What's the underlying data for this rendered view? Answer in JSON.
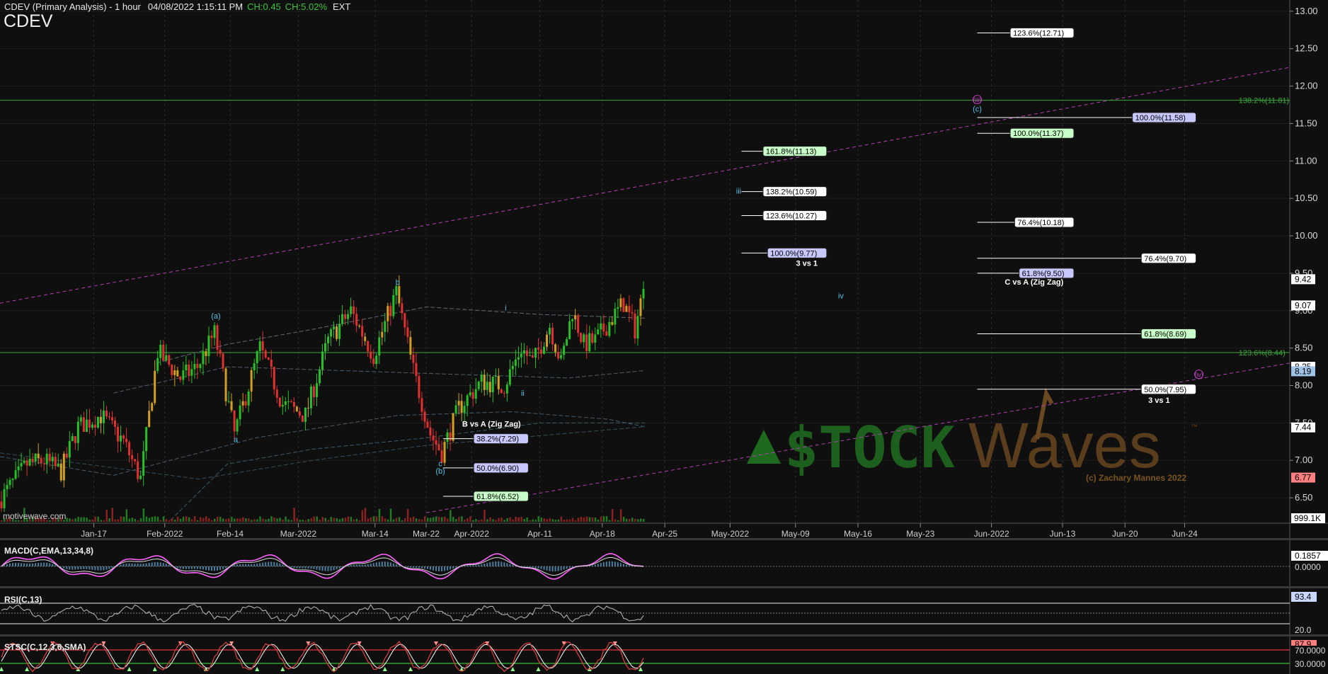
{
  "header": {
    "title": "CDEV (Primary Analysis) - 1 hour",
    "datetime": "04/08/2022 1:15:11 PM",
    "ch": "CH:0.45",
    "chpct": "CH:5.02%",
    "ext": "EXT",
    "symbol": "CDEV"
  },
  "watermark": {
    "word1": "$TOCK",
    "word2": "Waves",
    "tm": "™",
    "copyright": "(c) Zachary Mannes 2022",
    "site": "motivewave.com"
  },
  "colors": {
    "background": "#0f0f0f",
    "grid": "#2c2c2c",
    "candle_up": "#28c028",
    "candle_down": "#e03030",
    "candle_neutral": "#d2a020",
    "wave_cyan": "#4fc3e6",
    "wave_magenta": "#c040c0",
    "fib_green": "#3aa83a",
    "macd_line": "#ff60ff",
    "rsi_line": "#bbbbbb",
    "stoch_line": "#e04040"
  },
  "chart_data": {
    "type": "candlestick",
    "symbol": "CDEV",
    "interval": "1 hour",
    "y_axis_ticks": [
      "13.00",
      "12.50",
      "12.00",
      "11.50",
      "11.00",
      "10.50",
      "10.00",
      "9.50",
      "9.00",
      "8.50",
      "8.00",
      "7.50",
      "7.00",
      "6.50"
    ],
    "y_tick_values": [
      13.0,
      12.5,
      12.0,
      11.5,
      11.0,
      10.5,
      10.0,
      9.5,
      9.0,
      8.5,
      8.0,
      7.5,
      7.0,
      6.5
    ],
    "ylim": [
      6.17,
      13.15
    ],
    "price_badges": [
      {
        "text": "9.42",
        "value": 9.42,
        "fill": "#ffffff",
        "color": "#000000"
      },
      {
        "text": "9.07",
        "value": 9.07,
        "fill": "#ffffff",
        "color": "#000000"
      },
      {
        "text": "8.25",
        "value": 8.25,
        "fill": "#ffffff",
        "color": "#000000"
      },
      {
        "text": "8.19",
        "value": 8.19,
        "fill": "#9ec3e6",
        "color": "#000000"
      },
      {
        "text": "7.44",
        "value": 7.44,
        "fill": "#ffffff",
        "color": "#000000"
      },
      {
        "text": "6.77",
        "value": 6.77,
        "fill": "#ff8080",
        "color": "#000000"
      }
    ],
    "volume_badge": "999.1K",
    "x_axis_labels": [
      "Jan-17",
      "Feb-2022",
      "Feb-14",
      "Mar-2022",
      "Mar-14",
      "Mar-22",
      "Apr-2022",
      "Apr-11",
      "Apr-18",
      "Apr-25",
      "May-2022",
      "May-09",
      "May-16",
      "May-23",
      "Jun-2022",
      "Jun-13",
      "Jun-20",
      "Jun-24"
    ],
    "x_axis_slots": [
      33,
      58,
      81,
      105,
      132,
      150,
      166,
      190,
      212,
      234,
      257,
      280,
      302,
      324,
      349,
      374,
      396,
      417
    ],
    "slot_count": 454,
    "price_path": [
      {
        "slot": 0,
        "price": 6.45
      },
      {
        "slot": 10,
        "price": 6.95
      },
      {
        "slot": 16,
        "price": 7.0
      },
      {
        "slot": 22,
        "price": 6.85
      },
      {
        "slot": 28,
        "price": 7.45
      },
      {
        "slot": 36,
        "price": 7.6
      },
      {
        "slot": 44,
        "price": 7.25
      },
      {
        "slot": 50,
        "price": 6.75
      },
      {
        "slot": 56,
        "price": 8.45
      },
      {
        "slot": 64,
        "price": 8.1
      },
      {
        "slot": 70,
        "price": 8.25
      },
      {
        "slot": 76,
        "price": 8.7
      },
      {
        "slot": 83,
        "price": 7.35
      },
      {
        "slot": 92,
        "price": 8.5
      },
      {
        "slot": 100,
        "price": 7.75
      },
      {
        "slot": 108,
        "price": 7.6
      },
      {
        "slot": 116,
        "price": 8.6
      },
      {
        "slot": 124,
        "price": 9.0
      },
      {
        "slot": 132,
        "price": 8.4
      },
      {
        "slot": 140,
        "price": 9.25
      },
      {
        "slot": 146,
        "price": 8.2
      },
      {
        "slot": 152,
        "price": 7.35
      },
      {
        "slot": 156,
        "price": 7.1
      },
      {
        "slot": 162,
        "price": 7.7
      },
      {
        "slot": 170,
        "price": 8.05
      },
      {
        "slot": 178,
        "price": 8.0
      },
      {
        "slot": 184,
        "price": 8.5
      },
      {
        "slot": 188,
        "price": 8.3
      },
      {
        "slot": 194,
        "price": 8.8
      },
      {
        "slot": 198,
        "price": 8.3
      },
      {
        "slot": 202,
        "price": 9.0
      },
      {
        "slot": 206,
        "price": 8.55
      },
      {
        "slot": 210,
        "price": 8.6
      },
      {
        "slot": 214,
        "price": 8.8
      },
      {
        "slot": 220,
        "price": 9.1
      },
      {
        "slot": 224,
        "price": 8.75
      },
      {
        "slot": 226,
        "price": 9.1
      },
      {
        "slot": 227,
        "price": 9.42
      }
    ],
    "candle_count": 227,
    "moving_averages": [
      {
        "name": "ma1",
        "color": "#5e6a78",
        "points": [
          [
            55,
            8.3
          ],
          [
            80,
            8.55
          ],
          [
            110,
            8.75
          ],
          [
            150,
            9.05
          ],
          [
            190,
            8.95
          ],
          [
            227,
            8.9
          ]
        ]
      },
      {
        "name": "ma2",
        "color": "#4e5e6e",
        "points": [
          [
            40,
            7.9
          ],
          [
            80,
            8.25
          ],
          [
            120,
            8.2
          ],
          [
            160,
            8.15
          ],
          [
            200,
            8.1
          ],
          [
            227,
            8.2
          ]
        ]
      },
      {
        "name": "ma3",
        "color": "#465a6a",
        "points": [
          [
            0,
            7.05
          ],
          [
            40,
            6.8
          ],
          [
            90,
            7.3
          ],
          [
            140,
            7.6
          ],
          [
            180,
            7.65
          ],
          [
            214,
            7.55
          ],
          [
            227,
            7.45
          ]
        ]
      },
      {
        "name": "ma4",
        "color": "#3c5a6a",
        "points": [
          [
            60,
            6.2
          ],
          [
            80,
            6.95
          ],
          [
            110,
            7.15
          ],
          [
            150,
            7.3
          ],
          [
            190,
            7.5
          ],
          [
            227,
            7.5
          ]
        ]
      },
      {
        "name": "ma5",
        "color": "#334e5c",
        "points": [
          [
            0,
            7.1
          ],
          [
            30,
            6.95
          ],
          [
            70,
            6.75
          ],
          [
            110,
            7.0
          ],
          [
            150,
            7.2
          ],
          [
            227,
            7.45
          ]
        ]
      }
    ],
    "channels": [
      {
        "from": [
          0,
          9.1
        ],
        "to": [
          454,
          12.25
        ],
        "color": "#b040b0"
      },
      {
        "from": [
          150,
          6.3
        ],
        "to": [
          454,
          8.3
        ],
        "color": "#b040b0"
      }
    ],
    "fib_lines": [
      {
        "price": 11.81,
        "label": "138.2%(11.81)",
        "color": "#3aa83a",
        "label_slot": 436
      },
      {
        "price": 8.44,
        "label": "123.6%(8.44)",
        "color": "#3aa83a",
        "label_slot": 436
      }
    ],
    "wave_labels": [
      {
        "text": "(a)",
        "slot": 76,
        "price": 8.93,
        "color": "#4fc3e6"
      },
      {
        "text": "a",
        "slot": 83,
        "price": 7.28,
        "color": "#4fc3e6"
      },
      {
        "text": "b",
        "slot": 140,
        "price": 9.38,
        "color": "#4fc3e6"
      },
      {
        "text": "c",
        "slot": 155,
        "price": 6.96,
        "color": "#4fc3e6"
      },
      {
        "text": "(b)",
        "slot": 155,
        "price": 6.86,
        "color": "#4fc3e6"
      },
      {
        "text": "i",
        "slot": 178,
        "price": 9.04,
        "color": "#4fc3e6"
      },
      {
        "text": "ii",
        "slot": 184,
        "price": 7.9,
        "color": "#4fc3e6"
      },
      {
        "text": "iii",
        "slot": 260,
        "price": 10.6,
        "color": "#4fc3e6"
      },
      {
        "text": "iv",
        "slot": 296,
        "price": 9.2,
        "color": "#4fc3e6"
      },
      {
        "text": "(c)",
        "slot": 344,
        "price": 11.7,
        "color": "#4fc3e6"
      },
      {
        "text": "(iii)",
        "slot": 344,
        "price": 11.82,
        "color": "#c040c0"
      },
      {
        "text": "(iv)",
        "slot": 422,
        "price": 8.15,
        "color": "#c040c0"
      }
    ],
    "fib_targets": [
      {
        "label": "123.6%(12.71)",
        "price": 12.71,
        "x0": 344,
        "x1": 376,
        "fill": "#ffffff"
      },
      {
        "label": "100.0%(11.58)",
        "price": 11.58,
        "x0": 344,
        "x1": 419,
        "fill": "#c8c8ff"
      },
      {
        "label": "100.0%(11.37)",
        "price": 11.37,
        "x0": 344,
        "x1": 376,
        "fill": "#c8ffc8"
      },
      {
        "label": "161.8%(11.13)",
        "price": 11.13,
        "x0": 261,
        "x1": 289,
        "fill": "#c8ffc8"
      },
      {
        "label": "138.2%(10.59)",
        "price": 10.59,
        "x0": 261,
        "x1": 289,
        "fill": "#ffffff"
      },
      {
        "label": "123.6%(10.27)",
        "price": 10.27,
        "x0": 261,
        "x1": 289,
        "fill": "#ffffff"
      },
      {
        "label": "76.4%(10.18)",
        "price": 10.18,
        "x0": 344,
        "x1": 376,
        "fill": "#ffffff"
      },
      {
        "label": "100.0%(9.77)",
        "price": 9.77,
        "x0": 261,
        "x1": 289,
        "fill": "#c8c8ff"
      },
      {
        "label": "76.4%(9.70)",
        "price": 9.7,
        "x0": 344,
        "x1": 419,
        "fill": "#ffffff"
      },
      {
        "label": "61.8%(9.50)",
        "price": 9.5,
        "x0": 344,
        "x1": 376,
        "fill": "#c8c8ff"
      },
      {
        "label": "61.8%(8.69)",
        "price": 8.69,
        "x0": 344,
        "x1": 419,
        "fill": "#c8ffc8"
      },
      {
        "label": "50.0%(7.95)",
        "price": 7.95,
        "x0": 344,
        "x1": 419,
        "fill": "#ffffff"
      },
      {
        "label": "38.2%(7.29)",
        "price": 7.29,
        "x0": 156,
        "x1": 184,
        "fill": "#c8c8ff"
      },
      {
        "label": "50.0%(6.90)",
        "price": 6.9,
        "x0": 156,
        "x1": 184,
        "fill": "#c8c8ff"
      },
      {
        "label": "61.8%(6.52)",
        "price": 6.52,
        "x0": 156,
        "x1": 184,
        "fill": "#c8ffc8"
      }
    ],
    "annotations": [
      {
        "text": "3 vs 1",
        "slot": 284,
        "price": 9.6
      },
      {
        "text": "C vs A (Zig Zag)",
        "slot": 364,
        "price": 9.35
      },
      {
        "text": "3 vs 1",
        "slot": 408,
        "price": 7.77
      },
      {
        "text": "B vs A (Zig Zag)",
        "slot": 173,
        "price": 7.45
      }
    ],
    "indicators": [
      {
        "name": "MACD(C,EMA,13,34,8)",
        "badges": [
          {
            "text": "0.1857",
            "fill": "#ffffff"
          },
          {
            "text": "0.0000",
            "fill": "#0f0f0f"
          }
        ]
      },
      {
        "name": "RSI(C,13)",
        "badges": [
          {
            "text": "93.4",
            "fill": "#c8d8ff"
          },
          {
            "text": "20.0",
            "fill": "#0f0f0f"
          }
        ]
      },
      {
        "name": "STSC(C,12,3,6,SMA)",
        "badges": [
          {
            "text": "87.9",
            "fill": "#ff8080"
          },
          {
            "text": "70.0000",
            "fill": "#0f0f0f"
          },
          {
            "text": "30.0000",
            "fill": "#0f0f0f"
          }
        ]
      }
    ]
  }
}
